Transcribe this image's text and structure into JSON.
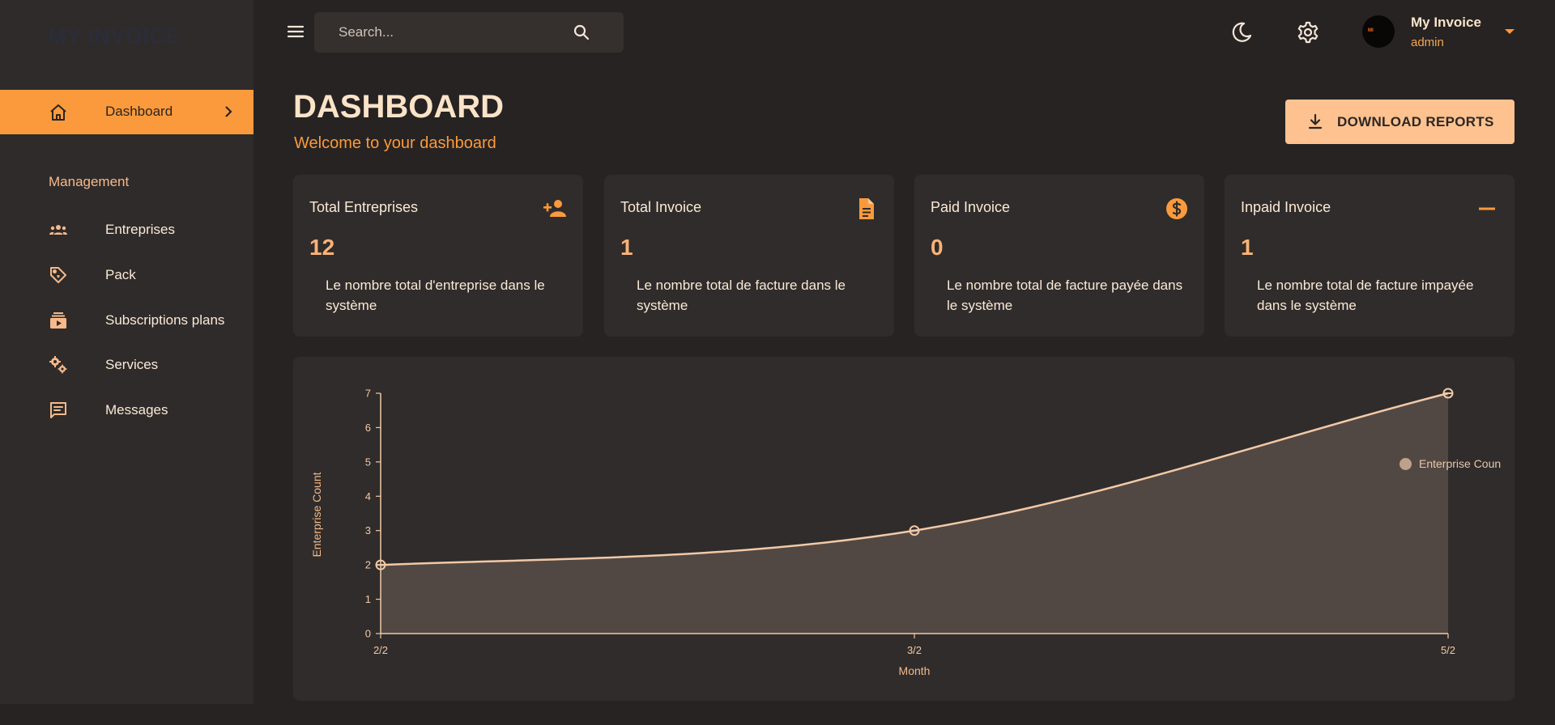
{
  "sidebar": {
    "logo": "MY INVOICE",
    "active_item": {
      "label": "Dashboard",
      "icon": "home-icon"
    },
    "section_title": "Management",
    "items": [
      {
        "label": "Entreprises",
        "icon": "users-icon"
      },
      {
        "label": "Pack",
        "icon": "tag-icon"
      },
      {
        "label": "Subscriptions plans",
        "icon": "subscriptions-icon"
      },
      {
        "label": "Services",
        "icon": "gears-icon"
      },
      {
        "label": "Messages",
        "icon": "message-icon"
      }
    ]
  },
  "topbar": {
    "search_placeholder": "Search...",
    "user": {
      "name": "My Invoice",
      "role": "admin"
    }
  },
  "header": {
    "title": "DASHBOARD",
    "subtitle": "Welcome to your dashboard",
    "download_label": "DOWNLOAD REPORTS"
  },
  "cards": [
    {
      "title": "Total Entreprises",
      "value": "12",
      "description": "Le nombre total d'entreprise dans le système",
      "icon": "person-add-icon"
    },
    {
      "title": "Total Invoice",
      "value": "1",
      "description": "Le nombre total de facture dans le système",
      "icon": "document-icon"
    },
    {
      "title": "Paid Invoice",
      "value": "0",
      "description": "Le nombre total de facture payée dans le système",
      "icon": "dollar-icon"
    },
    {
      "title": "Inpaid Invoice",
      "value": "1",
      "description": "Le nombre total de facture impayée dans le système",
      "icon": "minus-icon"
    }
  ],
  "colors": {
    "accent": "#fb9a3c",
    "accent_light": "#fdc290",
    "background": "#262322",
    "panel": "#2f2c2b"
  },
  "chart_data": {
    "type": "area",
    "categories": [
      "2/2",
      "3/2",
      "5/2"
    ],
    "series": [
      {
        "name": "Enterprise Coun",
        "values": [
          2,
          3,
          7
        ]
      }
    ],
    "xlabel": "Month",
    "ylabel": "Enterprise Count",
    "ylim": [
      0,
      7
    ],
    "yticks": [
      "0",
      "1",
      "2",
      "3",
      "4",
      "5",
      "6",
      "7"
    ],
    "grid": false,
    "legend_position": "right"
  }
}
